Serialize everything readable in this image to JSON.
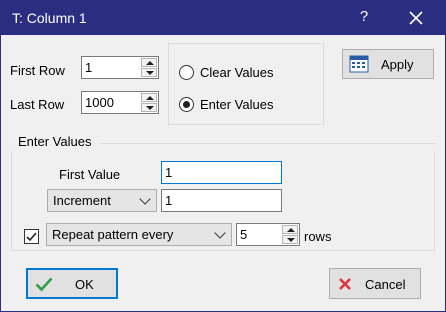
{
  "title": "T:  Column 1",
  "titlebar": {
    "help": "?"
  },
  "first_row": {
    "label": "First Row",
    "value": "1"
  },
  "last_row": {
    "label": "Last Row",
    "value": "1000"
  },
  "mode": {
    "clear_label": "Clear Values",
    "enter_label": "Enter Values",
    "selected": "enter"
  },
  "apply_label": "Apply",
  "enter_values": {
    "group_label": "Enter Values",
    "first_value_label": "First Value",
    "first_value": "1",
    "increment_option": "Increment",
    "increment_value": "1",
    "repeat_checked": true,
    "repeat_option": "Repeat pattern every",
    "repeat_value": "5",
    "rows_label": "rows"
  },
  "ok_label": "OK",
  "cancel_label": "Cancel",
  "colors": {
    "titlebar": "#2b2d80",
    "accent": "#0078d7",
    "ok_green": "#2f9e44",
    "cancel_red": "#d9363e"
  }
}
